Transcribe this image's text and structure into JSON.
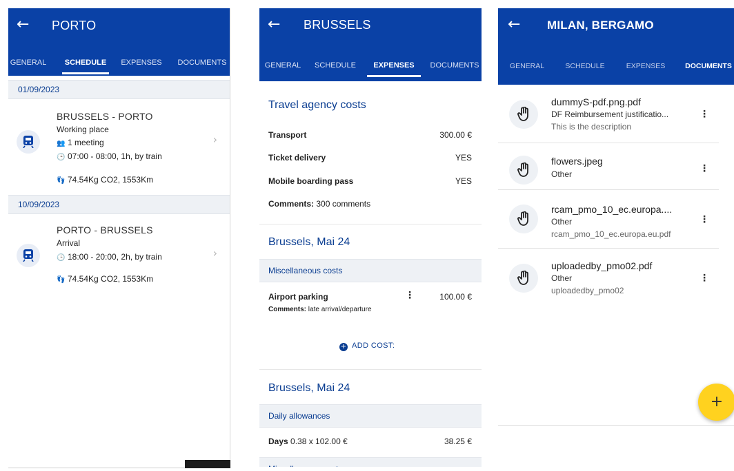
{
  "screens": {
    "schedule": {
      "title": "PORTO",
      "tabs": [
        "GENERAL",
        "SCHEDULE",
        "EXPENSES",
        "DOCUMENTS"
      ],
      "active_tab": "SCHEDULE",
      "days": [
        {
          "date": "01/09/2023",
          "trip": {
            "route": "BRUSSELS - PORTO",
            "place": "Working place",
            "meeting": "1 meeting",
            "time": "07:00 - 08:00, 1h, by train",
            "co2": "74.54Kg CO2, 1553Km"
          }
        },
        {
          "date": "10/09/2023",
          "trip": {
            "route": "PORTO - BRUSSELS",
            "place": "Arrival",
            "time": "18:00 - 20:00, 2h, by train",
            "co2": "74.54Kg CO2, 1553Km"
          }
        }
      ]
    },
    "expenses": {
      "title": "BRUSSELS",
      "tabs": [
        "GENERAL",
        "SCHEDULE",
        "EXPENSES",
        "DOCUMENTS"
      ],
      "active_tab": "EXPENSES",
      "agency": {
        "heading": "Travel agency costs",
        "transport_label": "Transport",
        "transport_value": "300.00 €",
        "ticket_label": "Ticket delivery",
        "ticket_value": "YES",
        "boarding_label": "Mobile boarding pass",
        "boarding_value": "YES",
        "comments_label": "Comments:",
        "comments_value": "300 comments"
      },
      "section1": {
        "heading": "Brussels, Mai 24",
        "band": "Miscellaneous costs",
        "item_label": "Airport parking",
        "item_value": "100.00 €",
        "item_comments_label": "Comments:",
        "item_comments_value": "late arrival/departure",
        "add_cost": "ADD COST:"
      },
      "section2": {
        "heading": "Brussels, Mai 24",
        "band": "Daily allowances",
        "days_label": "Days",
        "days_calc": "0.38 x 102.00 €",
        "days_value": "38.25 €",
        "band2": "Miscellaneous costs"
      }
    },
    "documents": {
      "title": "MILAN, BERGAMO",
      "tabs": [
        "GENERAL",
        "SCHEDULE",
        "EXPENSES",
        "DOCUMENTS"
      ],
      "active_tab": "DOCUMENTS",
      "files": [
        {
          "name": "dummyS-pdf.png.pdf",
          "type": "DF Reimbursement justificatio...",
          "description": "This is the description"
        },
        {
          "name": "flowers.jpeg",
          "type": "Other"
        },
        {
          "name": "rcam_pmo_10_ec.europa....",
          "type": "Other",
          "description": "rcam_pmo_10_ec.europa.eu.pdf"
        },
        {
          "name": "uploadedby_pmo02.pdf",
          "type": "Other",
          "description": "uploadedby_pmo02"
        }
      ],
      "fab_label": "+"
    }
  },
  "colors": {
    "primary": "#0a41a6",
    "accent_text": "#0a3d91",
    "band_bg": "#eef1f5",
    "positive": "#2e9e4c",
    "fab": "#ffd21f"
  },
  "icons": {
    "back": "arrow-left-icon",
    "train": "train-icon",
    "people": "people-icon",
    "clock": "clock-icon",
    "footprint": "footprint-icon",
    "chevron": "chevron-right-icon",
    "more": "more-vert-icon",
    "attachment": "hand-pointer-icon",
    "add": "plus-icon"
  }
}
